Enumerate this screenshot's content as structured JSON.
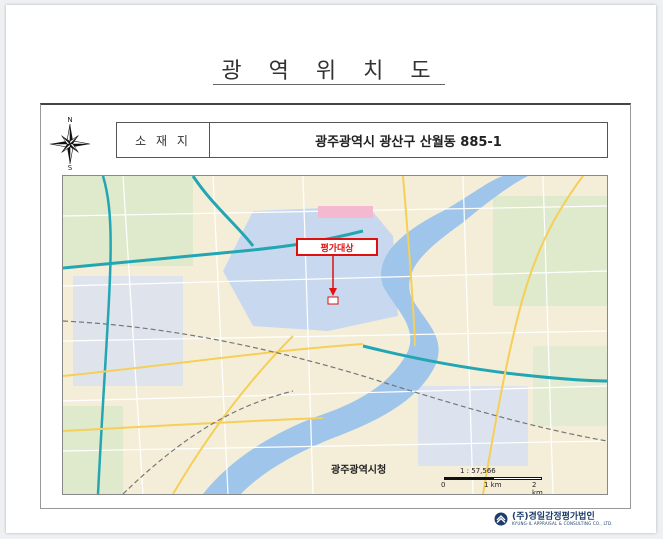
{
  "document": {
    "title": "광 역 위 치 도",
    "info": {
      "label": "소 재 지",
      "value": "광주광역시 광산구 산월동 885-1"
    }
  },
  "compass": {
    "north": "N",
    "south": "S"
  },
  "map": {
    "target_label": "평가대상",
    "city_hall_label": "광주광역시청",
    "scale": {
      "ratio": "1 : 57,566",
      "ticks": [
        "0",
        "1 km",
        "2 km"
      ]
    }
  },
  "footer": {
    "company_kr": "(주)경일감정평가법인",
    "company_en": "KYUNG-IL APPRAISAL & CONSULTING CO., LTD."
  },
  "colors": {
    "river": "#9fc5ea",
    "land": "#f4eed9",
    "highway": "#23a6b3",
    "target": "#e01010",
    "logo": "#1d3d6b"
  }
}
